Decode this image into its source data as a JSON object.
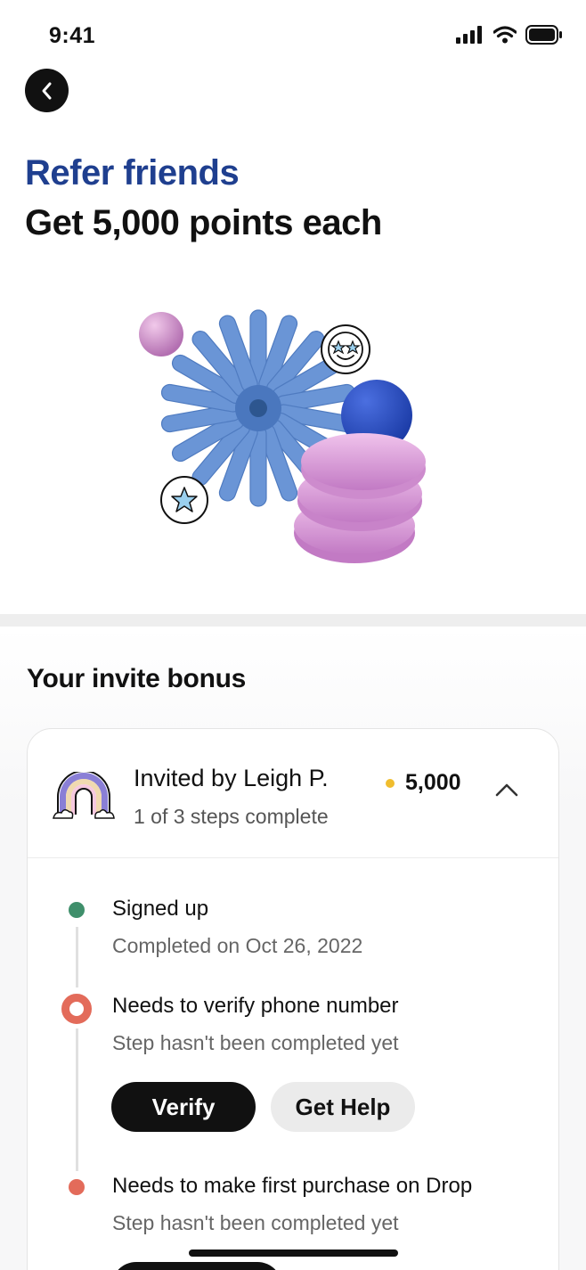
{
  "status_bar": {
    "time": "9:41"
  },
  "hero": {
    "eyebrow": "Refer friends",
    "title": "Get 5,000 points each"
  },
  "section": {
    "title": "Your invite bonus"
  },
  "invite": {
    "name": "Invited by Leigh P.",
    "progress": "1 of 3 steps complete",
    "points": "5,000"
  },
  "steps": [
    {
      "title": "Signed up",
      "subtitle": "Completed on Oct 26, 2022",
      "status": "complete"
    },
    {
      "title": "Needs to verify phone number",
      "subtitle": "Step hasn't been completed yet",
      "status": "current"
    },
    {
      "title": "Needs to make first purchase on Drop",
      "subtitle": "Step hasn't been completed yet",
      "status": "pending"
    }
  ],
  "actions": {
    "verify_label": "Verify",
    "help_label": "Get Help"
  },
  "icons": {
    "back": "chevron-left-icon",
    "collapse": "chevron-up-icon",
    "invite": "rainbow-icon"
  },
  "colors": {
    "brand_blue": "#1f3f8f",
    "complete_green": "#3f8f6b",
    "pending_red": "#e36b5a",
    "points_gold": "#f0bd2e"
  }
}
